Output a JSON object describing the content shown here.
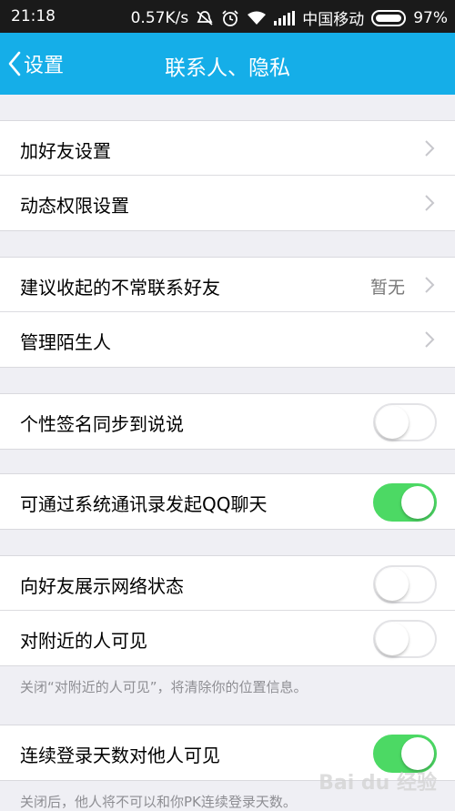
{
  "status_bar": {
    "time": "21:18",
    "speed": "0.57K/s",
    "carrier": "中国移动",
    "battery": "97%",
    "battery_level": 0.97
  },
  "nav": {
    "back_label": "设置",
    "title": "联系人、隐私"
  },
  "group1": {
    "items": [
      {
        "label": "加好友设置"
      },
      {
        "label": "动态权限设置"
      }
    ]
  },
  "group2": {
    "items": [
      {
        "label": "建议收起的不常联系好友",
        "value": "暂无"
      },
      {
        "label": "管理陌生人"
      }
    ]
  },
  "group3": {
    "items": [
      {
        "label": "个性签名同步到说说",
        "enabled": false
      }
    ]
  },
  "group4": {
    "items": [
      {
        "label": "可通过系统通讯录发起QQ聊天",
        "enabled": true
      }
    ]
  },
  "group5": {
    "items": [
      {
        "label": "向好友展示网络状态",
        "enabled": false
      },
      {
        "label": "对附近的人可见",
        "enabled": false
      }
    ],
    "note": "关闭“对附近的人可见”，将清除你的位置信息。"
  },
  "group6": {
    "items": [
      {
        "label": "连续登录天数对他人可见",
        "enabled": true
      }
    ],
    "note": "关闭后，他人将不可以和你PK连续登录天数。"
  },
  "watermark": "Bai du 经验",
  "colors": {
    "nav_bg": "#15aee8",
    "toggle_on": "#4cd964",
    "page_bg": "#efeff4"
  }
}
